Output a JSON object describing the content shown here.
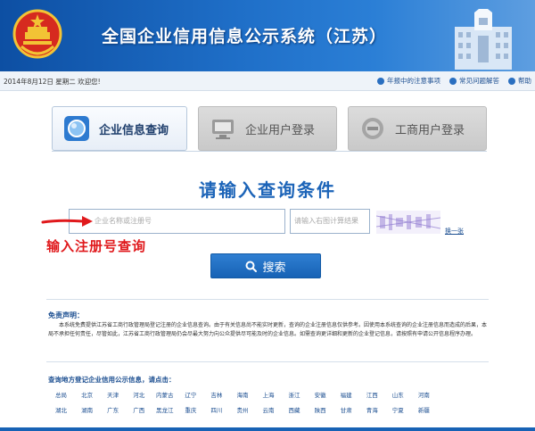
{
  "header": {
    "title": "全国企业信用信息公示系统（江苏）"
  },
  "infobar": {
    "date": "2014年8月12日 星期二  欢迎您!",
    "links": [
      {
        "label": "年报中的注意事项",
        "icon": "info-icon"
      },
      {
        "label": "常见问题解答",
        "icon": "question-icon"
      },
      {
        "label": "帮助",
        "icon": "help-icon"
      }
    ]
  },
  "tabs": [
    {
      "label": "企业信息查询",
      "icon": "search-globe-icon",
      "active": true
    },
    {
      "label": "企业用户登录",
      "icon": "monitor-icon",
      "active": false
    },
    {
      "label": "工商用户登录",
      "icon": "badge-icon",
      "active": false
    }
  ],
  "query": {
    "title": "请输入查询条件",
    "search_placeholder": "企业名称或注册号",
    "captcha_placeholder": "请输入右图计算结果",
    "refresh_label": "换一张",
    "button_label": "搜索"
  },
  "annotation": {
    "hint": "输入注册号查询"
  },
  "disclaimer": {
    "title": "免责声明：",
    "text": "本系统免费提供江苏省工商行政管理局登记注册的企业信息查询。由于有关信息尚不能实时更新，查询的企业注册信息仅供参考。因使用本系统查询的企业注册信息而造成的后果，本局不承担任何责任，尽管如此，江苏省工商行政管理局仍会尽最大努力向公众提供尽可能及时的企业信息。如需查询更详细和更新的企业登记信息，请按照有申请公开信息程序办理。"
  },
  "provinces": {
    "title": "查询地方登记企业信用公示信息，请点击：",
    "items": [
      "总局",
      "北京",
      "天津",
      "河北",
      "内蒙古",
      "辽宁",
      "吉林",
      "海南",
      "上海",
      "浙江",
      "安徽",
      "福建",
      "江西",
      "山东",
      "河南",
      "湖北",
      "湖南",
      "广东",
      "广西",
      "黑龙江",
      "重庆",
      "四川",
      "贵州",
      "云南",
      "西藏",
      "陕西",
      "甘肃",
      "青海",
      "宁夏",
      "新疆"
    ]
  },
  "colors": {
    "brand_blue": "#1c64b8",
    "hint_red": "#e0191c"
  }
}
